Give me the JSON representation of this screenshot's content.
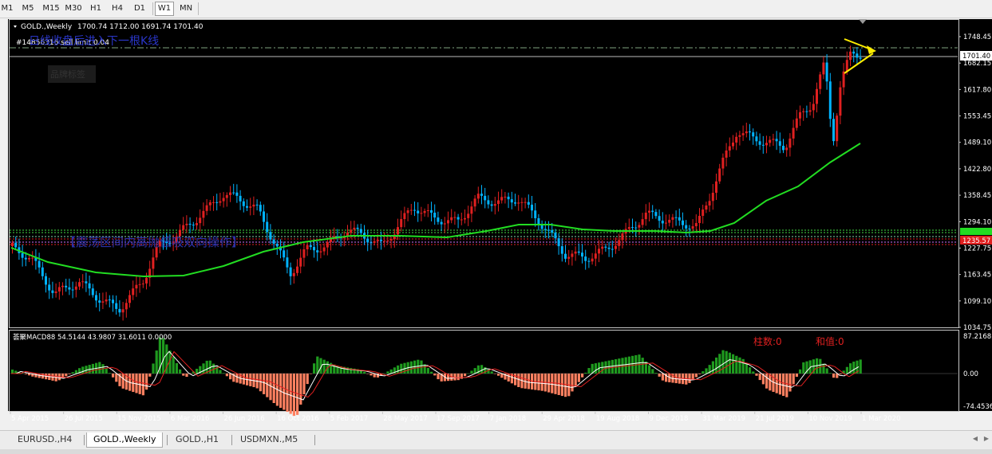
{
  "timeframes": [
    "M1",
    "M5",
    "M15",
    "M30",
    "H1",
    "H4",
    "D1",
    "W1",
    "MN"
  ],
  "active_timeframe": "W1",
  "chart": {
    "title": "GOLD.,Weekly",
    "ohlc": "1700.74 1712.00 1691.74 1701.40",
    "overlay_note": "日线收盘后进入下一根K线",
    "order_label": "#14856316 sell limit 0.04",
    "shade_box_text": "品牌标签",
    "range_note": "【震荡区间内高抛低吸双向操作】",
    "current_price": "1701.40",
    "red_line_label": "1235.57",
    "price_axis": [
      "1748.45",
      "1682.15",
      "1617.80",
      "1553.45",
      "1489.10",
      "1422.80",
      "1358.45",
      "1294.10",
      "1227.75",
      "1163.45",
      "1099.10",
      "1034.75"
    ],
    "macd_title": "荟聚MACD88 54.5144 43.9807 31.6011 0.0000",
    "macd_axis": [
      "87.2168",
      "0.00",
      "-74.4536"
    ],
    "bar_count_label": "柱数:0",
    "sum_label": "和值:0",
    "date_axis": [
      "5 Apr 2015",
      "26 Jul 2015",
      "15 Nov 2015",
      "6 Mar 2016",
      "26 Jun 2016",
      "16 Oct 2016",
      "5 Feb 2017",
      "28 May 2017",
      "17 Sep 2017",
      "7 Jan 2018",
      "29 Apr 2018",
      "19 Aug 2018",
      "9 Dec 2018",
      "31 Mar 2019",
      "21 Jul 2019",
      "10 Nov 2019",
      "1 Mar 2020"
    ],
    "colors": {
      "bull": "#e02020",
      "bear": "#00b3ff",
      "ma": "#22dd22",
      "macd_pos": "#1f9a1f",
      "macd_neg": "#ff8060",
      "arrow": "#ffee00",
      "bg": "#000000"
    }
  },
  "tabs": [
    "EURUSD.,H4",
    "GOLD.,Weekly",
    "GOLD.,H1",
    "USDMXN.,M5"
  ],
  "active_tab": "GOLD.,Weekly"
}
